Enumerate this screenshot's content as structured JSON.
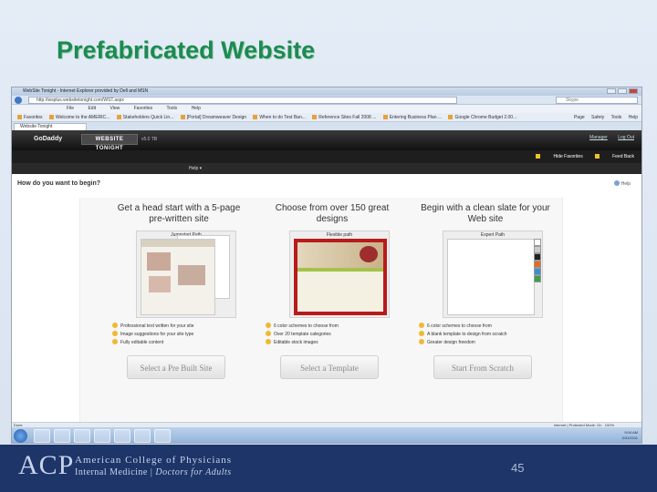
{
  "slide": {
    "title": "Prefabricated Website",
    "page_number": "45"
  },
  "browser": {
    "window_title": "WebSite Tonight - Internet Explorer provided by Dell and MSN",
    "url": "http://wsplus.websitetonight.com/WST.aspx",
    "search_placeholder": "Skype",
    "menu": [
      "File",
      "Edit",
      "View",
      "Favorites",
      "Tools",
      "Help"
    ],
    "favorites": [
      "Favorites",
      "Welcome to the AMERIC...",
      "Stakeholders Quick Lin...",
      "[Portal] Dreamweaver Design",
      "When to do Test Ban...",
      "Reference Sites Fall 2008 ...",
      "Entering Business Plan ...",
      "Google Chrome Budget 2.00..."
    ],
    "tools": [
      "Page",
      "Safety",
      "Tools",
      "Help"
    ],
    "tab_label": "Website Tonight",
    "status_text": "Done",
    "zone_text": "Internet | Protected Mode: On",
    "zoom": "100%",
    "clock_time": "9:04 AM",
    "clock_date": "3/31/2011"
  },
  "app": {
    "logo": "GoDaddy",
    "title": "WEBSITE TONIGHT",
    "version": "v5.0 TB",
    "header_links": [
      "Manager",
      "Log Out"
    ],
    "sub_links": [
      "Hide Favorites",
      "Feed Back"
    ],
    "help_menu": "Help"
  },
  "main": {
    "question": "How do you want to begin?",
    "help_label": "Help",
    "columns": [
      {
        "heading": "Get a head start with a 5-page pre-written site",
        "box_label": "Jumpstart Path",
        "bullets": [
          "Professional text written for your site",
          "Image suggestions for your site type",
          "Fully editable content"
        ],
        "button": "Select a Pre Built Site"
      },
      {
        "heading": "Choose from over 150 great designs",
        "box_label": "Flexible path",
        "bullets": [
          "6 color schemes to choose from",
          "Over 20 template categories",
          "Editable stock images"
        ],
        "button": "Select a Template"
      },
      {
        "heading": "Begin with a clean slate for your Web site",
        "box_label": "Expert Path",
        "bullets": [
          "6 color schemes to choose from",
          "A blank template to design from scratch",
          "Greater design freedom"
        ],
        "button": "Start From Scratch"
      }
    ],
    "swatch_colors": [
      "#ffffff",
      "#cccccc",
      "#222222",
      "#e36c1e",
      "#3b8fd4",
      "#3da14a"
    ]
  },
  "footer": {
    "acp_mark": "ACP",
    "org_name": "American College of Physicians",
    "tagline_left": "Internal Medicine",
    "tagline_right": "Doctors for Adults"
  },
  "colors": {
    "title_green": "#1d8a52",
    "footer_navy": "#1d3569",
    "bullet_gold": "#f0b834"
  }
}
